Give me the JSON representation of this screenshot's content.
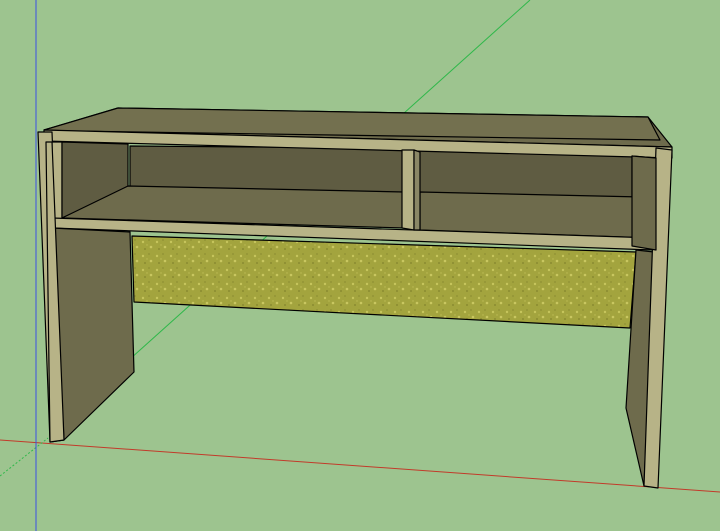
{
  "viewport": {
    "background_color": "#9dc48f"
  },
  "axes": {
    "red_axis_color": "#c23a2a",
    "green_axis_color": "#2fb84a",
    "blue_axis_color": "#3a50e6"
  },
  "model": {
    "object": "desk-with-shelves",
    "wood_face_color": "#b7b387",
    "wood_shadow_color": "#6e6b4c",
    "wood_dark_color": "#5f5c42",
    "edge_color": "#000000",
    "modesty_panel_texture_color": "#9ea03c",
    "modesty_panel_speckle_color": "#c2c25a"
  }
}
